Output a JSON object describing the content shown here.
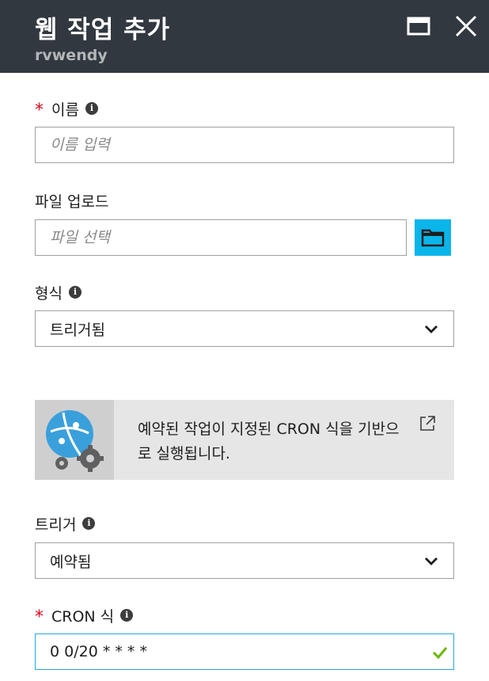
{
  "header": {
    "title": "웹 작업 추가",
    "subtitle": "rvwendy"
  },
  "icons": {
    "maximize": "maximize-icon",
    "close": "close-icon",
    "info": "info-icon",
    "folder": "folder-icon",
    "chevron": "chevron-down-icon",
    "external": "external-link-icon",
    "check": "check-icon"
  },
  "colors": {
    "header_bg": "#32383f",
    "accent": "#0ab5ea",
    "required": "#e00b1c",
    "valid": "#6bb700"
  },
  "form": {
    "name": {
      "required_mark": "*",
      "label": "이름",
      "info_glyph": "i",
      "placeholder": "이름 입력",
      "value": ""
    },
    "upload": {
      "label": "파일 업로드",
      "placeholder": "파일 선택"
    },
    "type": {
      "label": "형식",
      "info_glyph": "i",
      "value": "트리거됨"
    },
    "info_message": "예약된 작업이 지정된 CRON 식을 기반으로 실행됩니다.",
    "trigger": {
      "label": "트리거",
      "info_glyph": "i",
      "value": "예약됨"
    },
    "cron": {
      "required_mark": "*",
      "label": "CRON 식",
      "info_glyph": "i",
      "value": "0 0/20 * * * *"
    }
  }
}
